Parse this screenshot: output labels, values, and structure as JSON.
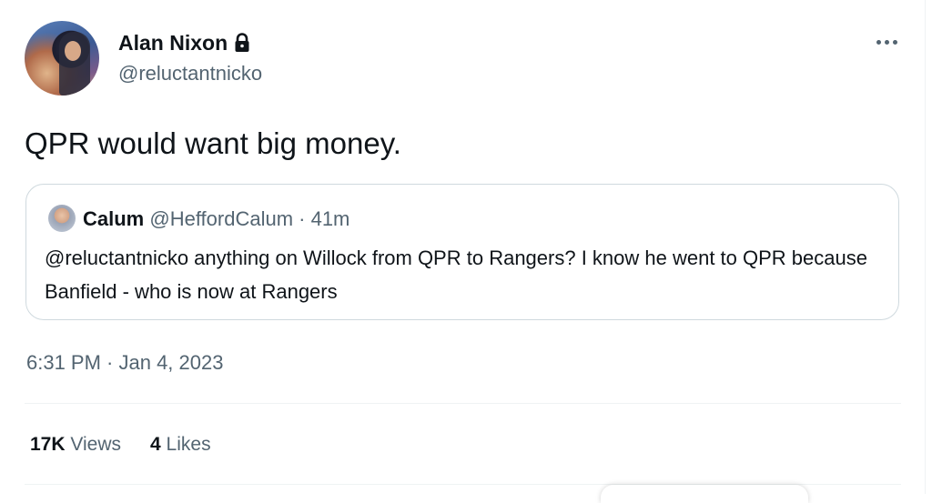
{
  "author": {
    "display_name": "Alan Nixon",
    "handle": "@reluctantnicko",
    "locked_icon": "lock-icon"
  },
  "tweet": {
    "text": "QPR would want big money.",
    "timestamp": "6:31 PM · Jan 4, 2023"
  },
  "quoted_tweet": {
    "display_name": "Calum",
    "handle_meta": "@HeffordCalum · 41m",
    "text": "@reluctantnicko anything on Willock from QPR to Rangers? I know he went to QPR because Banfield - who is now at Rangers"
  },
  "stats": {
    "views_count": "17K",
    "views_label": "Views",
    "likes_count": "4",
    "likes_label": "Likes"
  },
  "icons": {
    "more": "more-options-icon"
  },
  "colors": {
    "text_primary": "#0f1419",
    "text_secondary": "#536471",
    "border": "#cfd9de"
  }
}
